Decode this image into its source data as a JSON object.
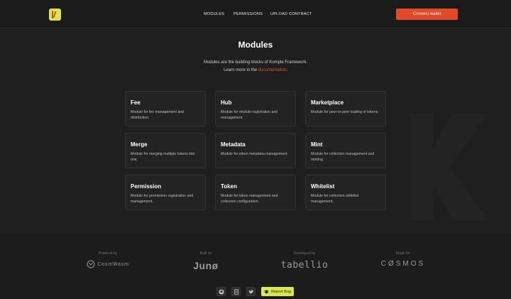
{
  "header": {
    "nav": [
      "MODULES",
      "PERMISSIONS",
      "UPLOAD CONTRACT"
    ],
    "connect_label": "Connect wallet"
  },
  "hero": {
    "title": "Modules",
    "line1": "Modules are the building blocks of Komple Framework.",
    "line2_prefix": "Learn more in the ",
    "link": "documentation",
    "line2_suffix": "."
  },
  "cards": [
    {
      "title": "Fee",
      "desc": "Module for fee management and distribution."
    },
    {
      "title": "Hub",
      "desc": "Module for module registration and management."
    },
    {
      "title": "Marketplace",
      "desc": "Module for peer-to-peer trading of tokens."
    },
    {
      "title": "Merge",
      "desc": "Module for merging multiple tokens into one."
    },
    {
      "title": "Metadata",
      "desc": "Module for token metadata management."
    },
    {
      "title": "Mint",
      "desc": "Module for collection management and minting."
    },
    {
      "title": "Permission",
      "desc": "Module for permission registration and management."
    },
    {
      "title": "Token",
      "desc": "Module for token management and collection configuration."
    },
    {
      "title": "Whitelist",
      "desc": "Module for collection whitelist management."
    }
  ],
  "footer": {
    "sponsors": [
      {
        "caption": "Powered by",
        "name": "CosmWasm"
      },
      {
        "caption": "Built on",
        "name": "Junø"
      },
      {
        "caption": "Developed by",
        "name": "tabellio"
      },
      {
        "caption": "Made for",
        "name": "CØSMOS"
      }
    ],
    "report_label": "Report Bug"
  },
  "colors": {
    "background": "#1f1f1f",
    "accent_orange": "#df4a28",
    "accent_lime": "#d9e84d"
  }
}
